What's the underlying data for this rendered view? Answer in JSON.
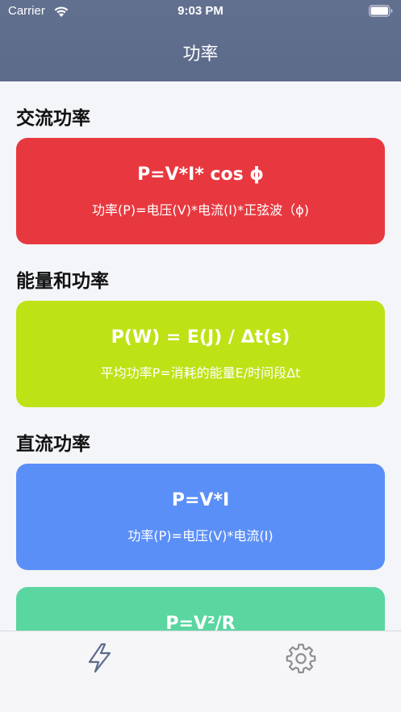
{
  "status_bar": {
    "carrier": "Carrier",
    "time": "9:03 PM"
  },
  "nav": {
    "title": "功率"
  },
  "sections": [
    {
      "title": "交流功率",
      "card": {
        "formula": "P=V*I* cos ϕ",
        "description": "功率(P)=电压(V)*电流(I)*正弦波（ϕ)",
        "color": "#e8383f"
      }
    },
    {
      "title": "能量和功率",
      "card": {
        "formula": "P(W) = E(J) / Δt(s)",
        "description": "平均功率P=消耗的能量E/时间段Δt",
        "color": "#bde216"
      }
    },
    {
      "title": "直流功率",
      "cards": [
        {
          "formula": "P=V*I",
          "description": "功率(P)=电压(V)*电流(I)",
          "color": "#5b8ff8"
        },
        {
          "formula": "P=V²/R",
          "color": "#5ad6a1"
        }
      ]
    }
  ],
  "tabbar": {
    "items": [
      {
        "icon": "lightning-icon",
        "selected": true,
        "color": "#5d6b8b"
      },
      {
        "icon": "gear-icon",
        "selected": false,
        "color": "#8e8e93"
      }
    ]
  }
}
